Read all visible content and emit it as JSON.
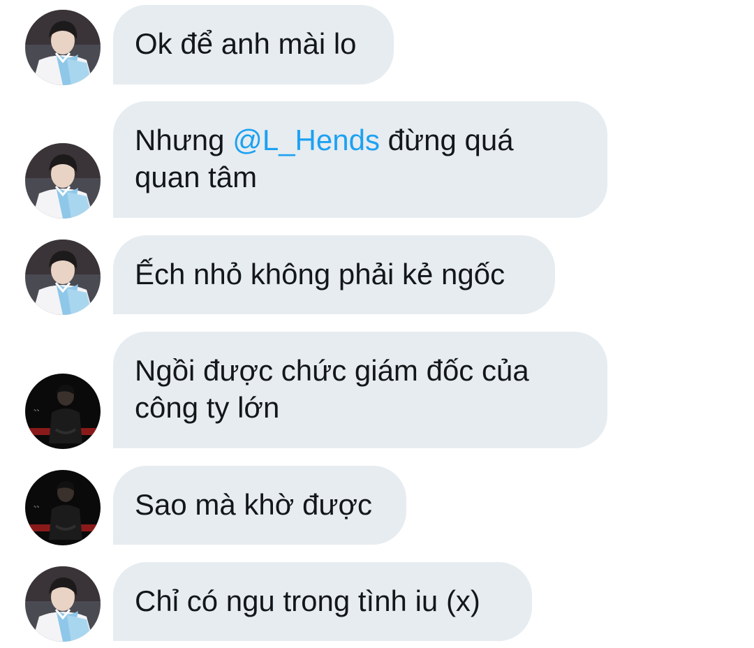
{
  "conversation": {
    "messages": [
      {
        "avatar": "avatar-hanbok-icon",
        "text": "Ok để anh mài lo"
      },
      {
        "avatar": "avatar-hanbok-icon",
        "text_before": "Nhưng ",
        "mention": "@L_Hends",
        "text_after": " đừng quá quan tâm"
      },
      {
        "avatar": "avatar-hanbok-icon",
        "text": "Ếch nhỏ không phải kẻ ngốc"
      },
      {
        "avatar": "avatar-dark-icon",
        "text": "Ngồi được chức giám đốc của công ty lớn"
      },
      {
        "avatar": "avatar-dark-icon",
        "text": "Sao mà khờ được"
      },
      {
        "avatar": "avatar-hanbok-icon",
        "text": "Chỉ có ngu trong tình iu (x)"
      }
    ]
  },
  "colors": {
    "bubble_bg": "#e6ecf0",
    "text": "#14171a",
    "mention": "#1da1f2"
  }
}
